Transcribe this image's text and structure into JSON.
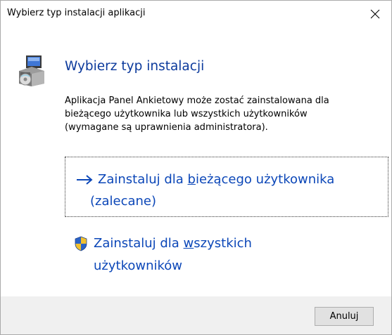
{
  "window": {
    "title": "Wybierz typ instalacji aplikacji",
    "close_icon": "close-icon"
  },
  "main": {
    "icon": "setup-package-icon",
    "heading": "Wybierz typ instalacji",
    "description_lines": [
      "Aplikacja Panel Ankietowy może zostać zainstalowana dla",
      "bieżącego użytkownika lub wszystkich użytkowników",
      "(wymagane są uprawnienia administratora)."
    ]
  },
  "options": {
    "current_user": {
      "icon": "arrow-right-icon",
      "line1_before": "Zainstaluj dla ",
      "line1_access": "b",
      "line1_after": "ieżącego użytkownika",
      "line2": "(zalecane)",
      "color": "#0c47b8"
    },
    "all_users": {
      "icon": "uac-shield-icon",
      "line1_before": "Zainstaluj dla ",
      "line1_access": "w",
      "line1_after": "szystkich",
      "line2": "użytkowników",
      "color": "#0c47b8"
    }
  },
  "footer": {
    "cancel_label": "Anuluj"
  },
  "colors": {
    "heading": "#0c3a9c",
    "footer_bg": "#f0f0f0"
  }
}
